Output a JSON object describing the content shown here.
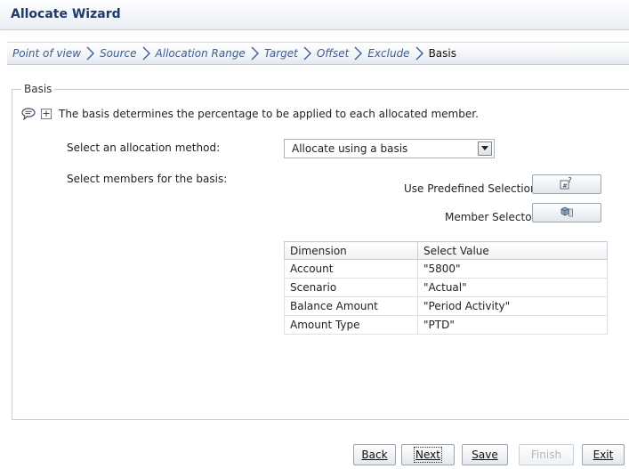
{
  "window": {
    "title": "Allocate Wizard"
  },
  "train": {
    "steps": [
      {
        "label": "Point of view"
      },
      {
        "label": "Source"
      },
      {
        "label": "Allocation Range"
      },
      {
        "label": "Target"
      },
      {
        "label": "Offset"
      },
      {
        "label": "Exclude"
      },
      {
        "label": "Basis"
      }
    ],
    "current": "Basis"
  },
  "basis": {
    "legend": "Basis",
    "info_text": "The basis determines the percentage to be applied to each allocated member.",
    "expand_symbol": "+",
    "method_label": "Select an allocation method:",
    "method_value": "Allocate using a basis",
    "members_label": "Select members for the basis:",
    "predefined_label": "Use Predefined Selection",
    "member_selector_label": "Member Selector"
  },
  "table": {
    "headers": [
      "Dimension",
      "Select Value"
    ],
    "rows": [
      [
        "Account",
        "\"5800\""
      ],
      [
        "Scenario",
        "\"Actual\""
      ],
      [
        "Balance Amount",
        "\"Period Activity\""
      ],
      [
        "Amount Type",
        "\"PTD\""
      ]
    ]
  },
  "buttons": {
    "back": "Back",
    "next": "Next",
    "save": "Save",
    "finish": "Finish",
    "exit": "Exit"
  },
  "icons": {
    "bubble": "speech-bubble-icon",
    "predefined": "predefined-selection-icon",
    "member_selector": "member-selector-icon",
    "dropdown": "chevron-down-icon"
  }
}
